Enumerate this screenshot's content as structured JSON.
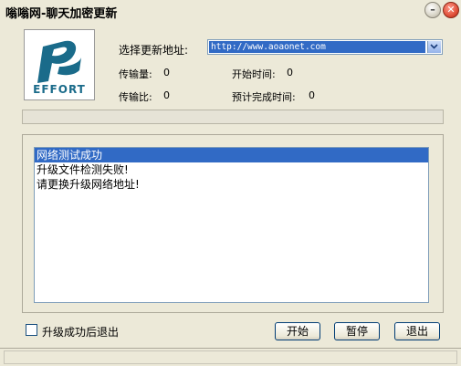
{
  "window": {
    "title": "嗡嗡网-聊天加密更新",
    "minimize_icon": "minimize-icon",
    "close_icon": "close-icon"
  },
  "logo": {
    "text": "EFFORT",
    "brand_color": "#1a6b8a"
  },
  "form": {
    "update_address_label": "选择更新地址:",
    "update_address_value": "http://www.aoaonet.com",
    "transfer_amount_label": "传输量:",
    "transfer_amount_value": "0",
    "start_time_label": "开始时间:",
    "start_time_value": "0",
    "transfer_ratio_label": "传输比:",
    "transfer_ratio_value": "0",
    "estimated_finish_label": "预计完成时间:",
    "estimated_finish_value": "0"
  },
  "progress": {
    "value": 0
  },
  "log": {
    "items": [
      "网络测试成功",
      "升级文件检测失败!",
      "请更换升级网络地址!"
    ],
    "selected_index": 0
  },
  "options": {
    "exit_after_upgrade_label": "升级成功后退出",
    "exit_after_upgrade_checked": false
  },
  "buttons": {
    "start_label": "开始",
    "pause_label": "暂停",
    "exit_label": "退出"
  },
  "status_bar": {
    "text": ""
  },
  "colors": {
    "selection": "#316ac5",
    "face": "#ece9d8"
  }
}
